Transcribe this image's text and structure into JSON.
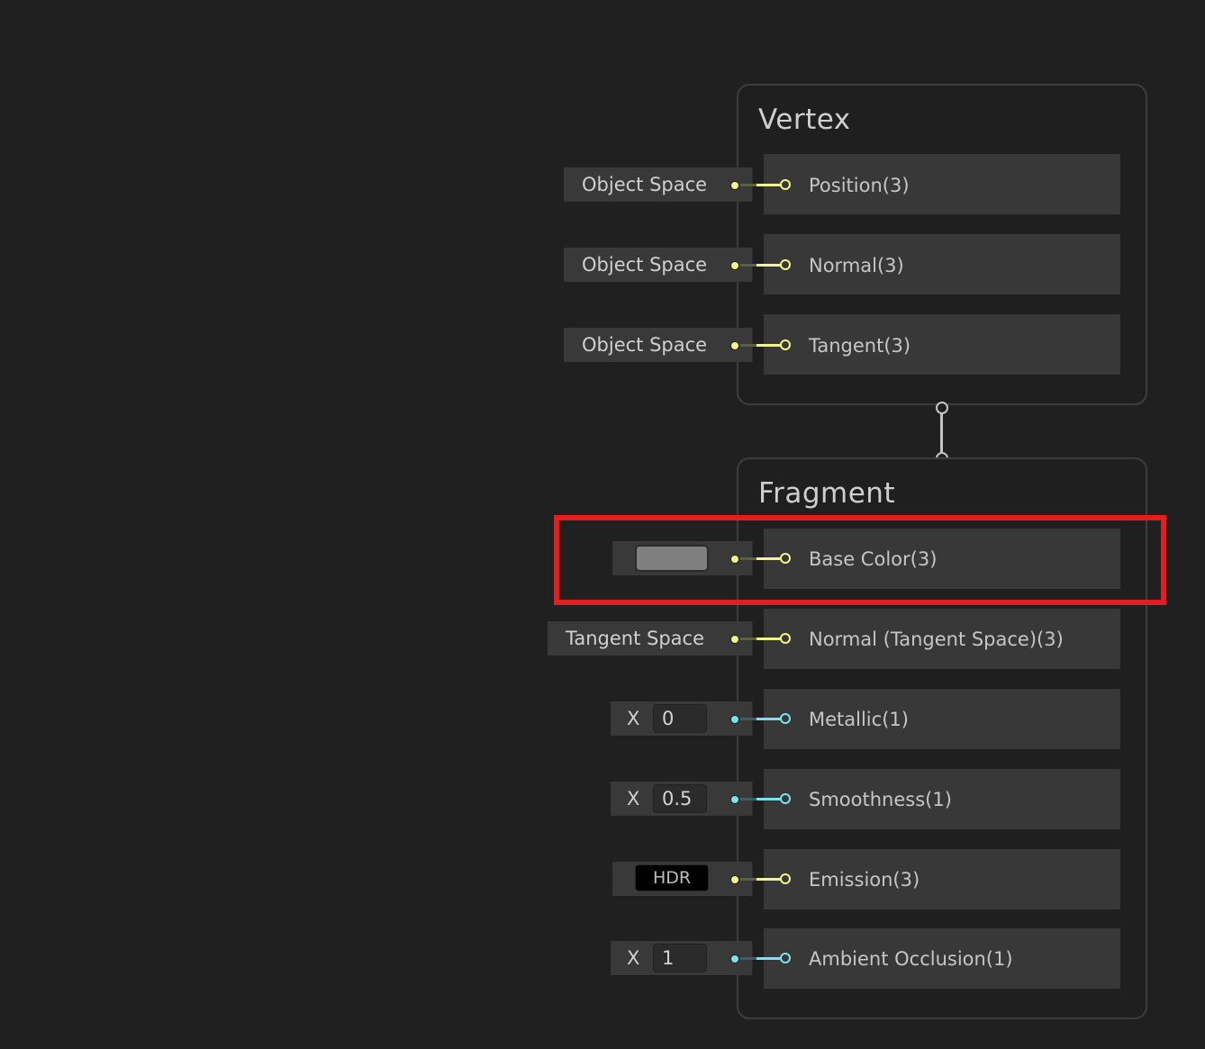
{
  "vertex": {
    "title": "Vertex",
    "blocks": [
      {
        "label": "Position(3)",
        "inline": "Object Space"
      },
      {
        "label": "Normal(3)",
        "inline": "Object Space"
      },
      {
        "label": "Tangent(3)",
        "inline": "Object Space"
      }
    ]
  },
  "fragment": {
    "title": "Fragment",
    "blocks": [
      {
        "label": "Base Color(3)",
        "swatch_color": "#7f7f7f"
      },
      {
        "label": "Normal (Tangent Space)(3)",
        "inline": "Tangent Space"
      },
      {
        "label": "Metallic(1)",
        "axis": "X",
        "value": "0"
      },
      {
        "label": "Smoothness(1)",
        "axis": "X",
        "value": "0.5"
      },
      {
        "label": "Emission(3)",
        "hdr": "HDR"
      },
      {
        "label": "Ambient Occlusion(1)",
        "axis": "X",
        "value": "1"
      }
    ]
  },
  "colors": {
    "vector3_port": "#f5f58a",
    "vector1_port": "#7ce3ee",
    "highlight": "#e41e1e"
  }
}
